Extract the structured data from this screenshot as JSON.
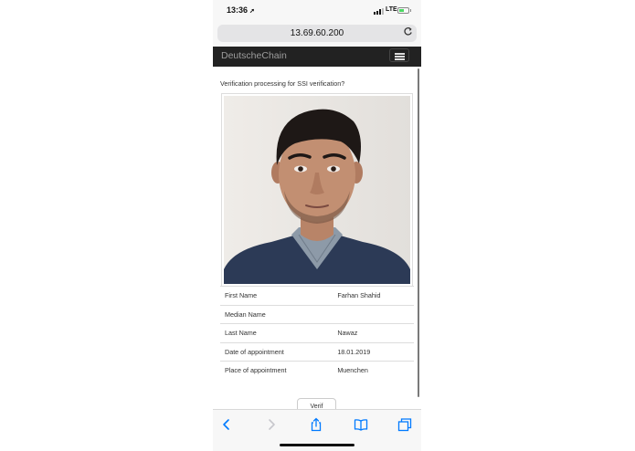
{
  "status_bar": {
    "time": "13:36",
    "network": "LTE"
  },
  "browser": {
    "url": "13.69.60.200"
  },
  "navbar": {
    "brand": "DeutscheChain"
  },
  "main": {
    "question": "Verification processing for SSI verification?",
    "details": [
      {
        "label": "First Name",
        "value": "Farhan Shahid"
      },
      {
        "label": "Median Name",
        "value": ""
      },
      {
        "label": "Last Name",
        "value": "Nawaz"
      },
      {
        "label": "Date of appointment",
        "value": "18.01.2019"
      },
      {
        "label": "Place of appointment",
        "value": "Muenchen"
      }
    ],
    "verify_button": "Verif"
  },
  "icons": [
    "location-arrow-icon",
    "signal-icon",
    "battery-icon",
    "reload-icon",
    "hamburger-icon",
    "back-icon",
    "forward-icon",
    "share-icon",
    "bookmarks-icon",
    "tabs-icon"
  ],
  "colors": {
    "navbar_bg": "#222222",
    "brand_text": "#9d9d9d",
    "ios_blue": "#007aff",
    "battery_green": "#4cd964"
  }
}
